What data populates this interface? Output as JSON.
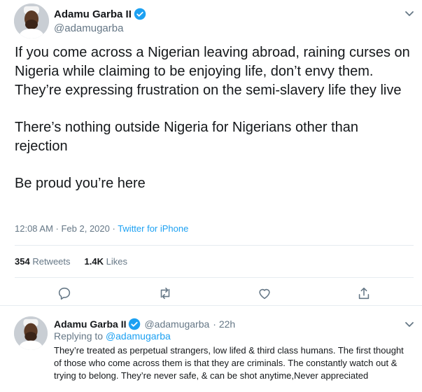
{
  "main_tweet": {
    "author_name": "Adamu Garba II",
    "author_handle": "@adamugarba",
    "paragraphs": [
      "If you come across a Nigerian leaving abroad, raining curses on Nigeria while claiming to be enjoying life, don’t envy them. They’re expressing frustration on the semi-slavery life they live",
      "There’s nothing outside Nigeria for Nigerians other than rejection",
      "Be proud you’re here"
    ],
    "timestamp": "12:08 AM · Feb 2, 2020 · ",
    "source": "Twitter for iPhone",
    "retweets_count": "354",
    "retweets_label": "Retweets",
    "likes_count": "1.4K",
    "likes_label": "Likes"
  },
  "reply_tweet": {
    "author_name": "Adamu Garba II",
    "author_handle": "@adamugarba",
    "age": "· 22h",
    "replying_prefix": "Replying to ",
    "replying_to": "@adamugarba",
    "text": "They’re treated as perpetual strangers, low lifed & third class humans. The first thought of those who come across them is that they are criminals. The constantly watch out & trying to belong. They’re never safe, & can be shot anytime,Never appreciated"
  },
  "icons": {
    "verified": "verified-badge-icon",
    "more": "chevron-down-icon",
    "reply": "reply-icon",
    "retweet": "retweet-icon",
    "like": "heart-icon",
    "share": "share-icon"
  },
  "colors": {
    "accent": "#1da1f2",
    "text": "#14171a",
    "muted": "#657786",
    "divider": "#e6ecf0"
  }
}
